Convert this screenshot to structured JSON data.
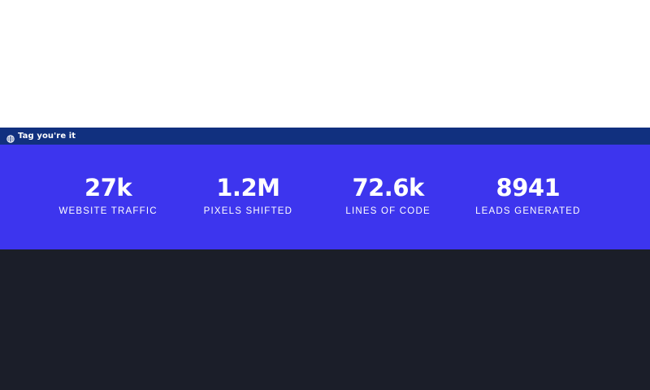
{
  "tag_bar": {
    "icon": "globe-icon",
    "label": "Tag you're it",
    "background": "#11307f"
  },
  "stats_section": {
    "background": "#3d35ee",
    "items": [
      {
        "value": "27k",
        "label": "WEBSITE TRAFFIC"
      },
      {
        "value": "1.2M",
        "label": "PIXELS SHIFTED"
      },
      {
        "value": "72.6k",
        "label": "LINES OF CODE"
      },
      {
        "value": "8941",
        "label": "LEADS GENERATED"
      }
    ]
  },
  "footer": {
    "background": "#1b1e29"
  }
}
